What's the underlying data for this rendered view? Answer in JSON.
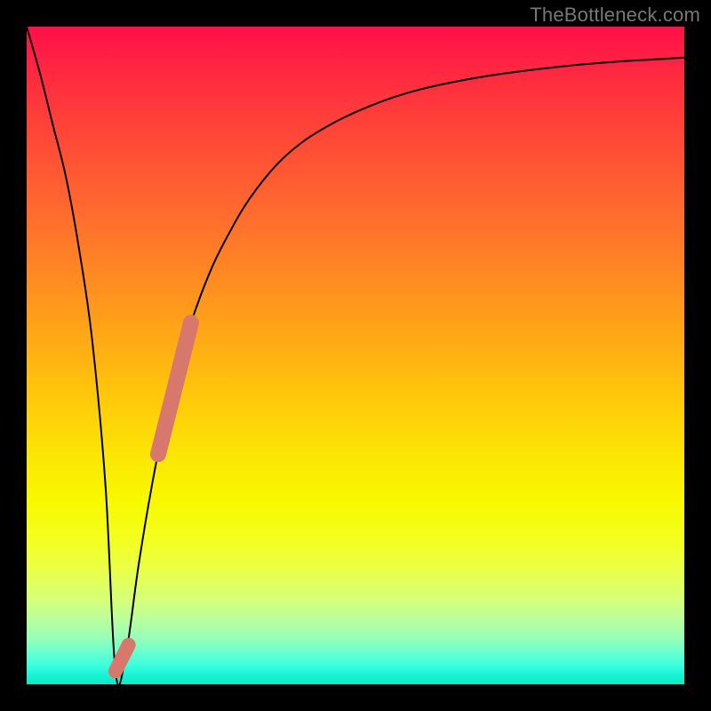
{
  "watermark": "TheBottleneck.com",
  "chart_data": {
    "type": "line",
    "title": "",
    "xlabel": "",
    "ylabel": "",
    "xlim": [
      0,
      100
    ],
    "ylim": [
      0,
      100
    ],
    "grid": false,
    "series": [
      {
        "name": "bottleneck-curve",
        "x": [
          0,
          2,
          4,
          6,
          8,
          10,
          12,
          13.5,
          15,
          17,
          19,
          21,
          23,
          25,
          28,
          31,
          34,
          38,
          42,
          46,
          50,
          55,
          60,
          65,
          70,
          75,
          80,
          85,
          90,
          95,
          100
        ],
        "y": [
          100,
          93,
          85,
          77,
          66,
          52,
          30,
          2,
          4,
          18,
          30,
          40,
          48,
          55,
          63,
          69,
          74,
          79,
          82.5,
          85,
          87,
          89,
          90.5,
          91.6,
          92.5,
          93.2,
          93.8,
          94.3,
          94.7,
          95,
          95.3
        ]
      },
      {
        "name": "highlight-segment",
        "x": [
          20,
          25
        ],
        "y": [
          35,
          55
        ]
      },
      {
        "name": "highlight-hook",
        "x": [
          13.5,
          15.5
        ],
        "y": [
          2,
          6
        ]
      }
    ]
  }
}
